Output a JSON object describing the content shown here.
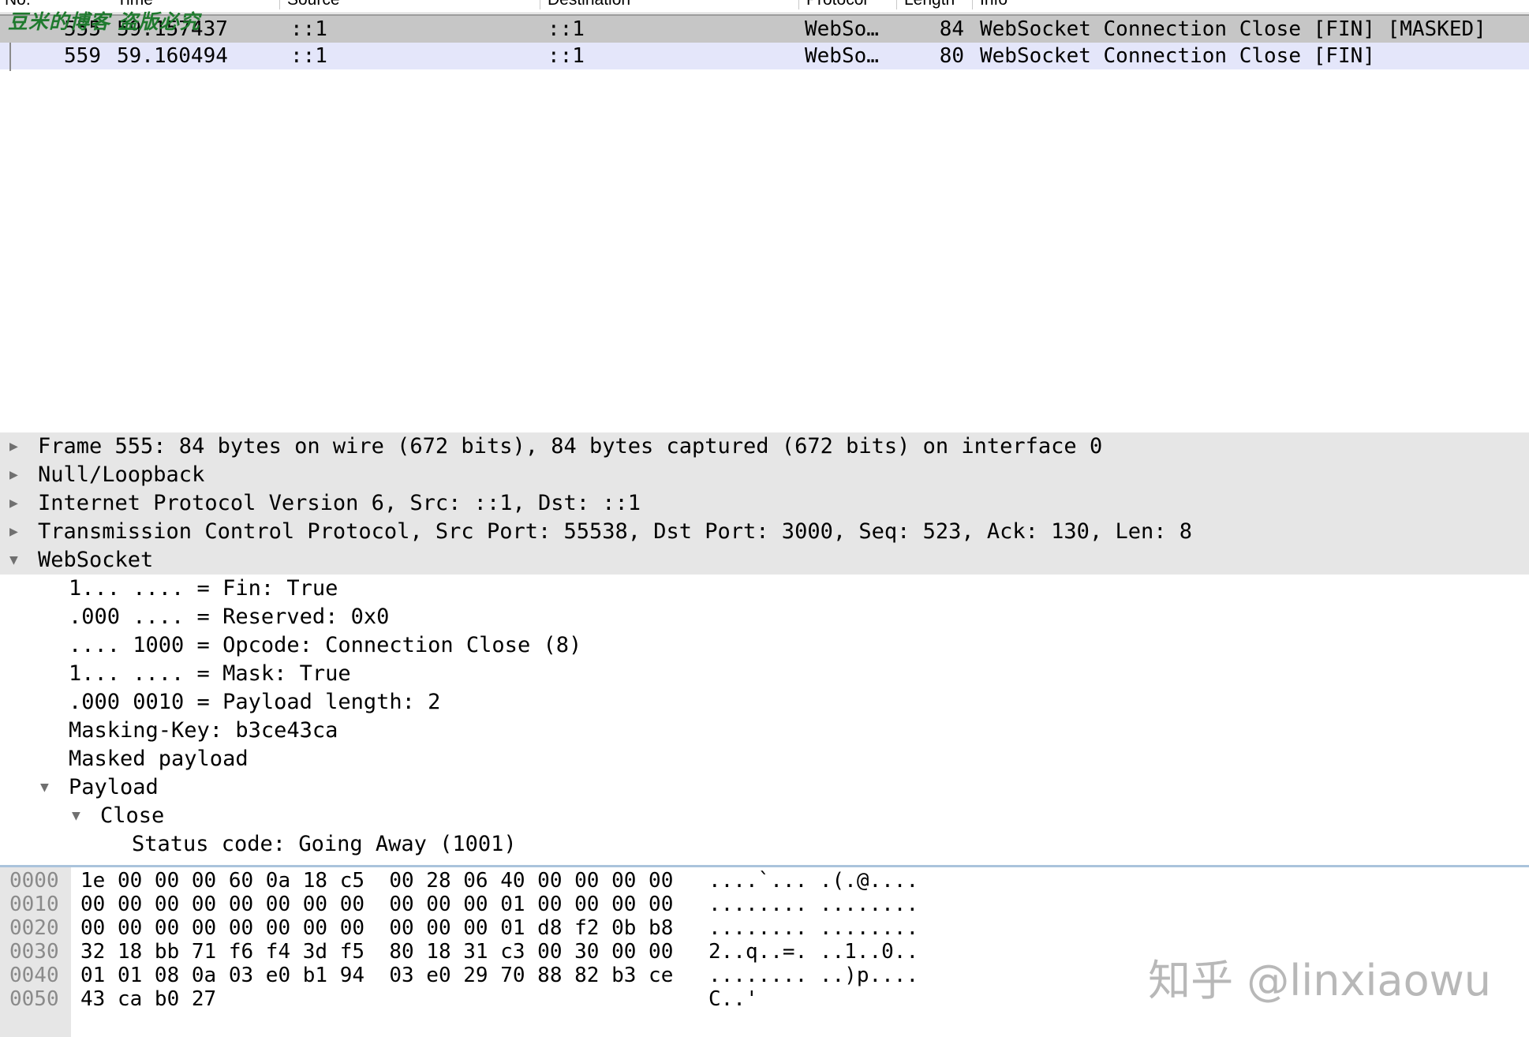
{
  "watermark_top": "豆米的博客 盗版必究",
  "watermark_bottom": "知乎 @linxiaowu",
  "packet_list": {
    "columns": [
      "No.",
      "Time",
      "Source",
      "Destination",
      "Protocol",
      "Length",
      "Info"
    ],
    "rows": [
      {
        "no": "555",
        "time": "59.157437",
        "source": "::1",
        "destination": "::1",
        "protocol": "WebSo…",
        "length": "84",
        "info": "WebSocket Connection Close [FIN] [MASKED]"
      },
      {
        "no": "559",
        "time": "59.160494",
        "source": "::1",
        "destination": "::1",
        "protocol": "WebSo…",
        "length": "80",
        "info": "WebSocket Connection Close [FIN]"
      }
    ]
  },
  "details": {
    "tree": [
      {
        "toggle": "▶",
        "text": "Frame 555: 84 bytes on wire (672 bits), 84 bytes captured (672 bits) on interface 0"
      },
      {
        "toggle": "▶",
        "text": "Null/Loopback"
      },
      {
        "toggle": "▶",
        "text": "Internet Protocol Version 6, Src: ::1, Dst: ::1"
      },
      {
        "toggle": "▶",
        "text": "Transmission Control Protocol, Src Port: 55538, Dst Port: 3000, Seq: 523, Ack: 130, Len: 8"
      },
      {
        "toggle": "▼",
        "text": "WebSocket"
      },
      {
        "toggle": "",
        "text": "1... .... = Fin: True"
      },
      {
        "toggle": "",
        "text": ".000 .... = Reserved: 0x0"
      },
      {
        "toggle": "",
        "text": ".... 1000 = Opcode: Connection Close (8)"
      },
      {
        "toggle": "",
        "text": "1... .... = Mask: True"
      },
      {
        "toggle": "",
        "text": ".000 0010 = Payload length: 2"
      },
      {
        "toggle": "",
        "text": "Masking-Key: b3ce43ca"
      },
      {
        "toggle": "",
        "text": "Masked payload"
      },
      {
        "toggle": "▼",
        "text": "Payload"
      },
      {
        "toggle": "▼",
        "text": "Close"
      },
      {
        "toggle": "",
        "text": "Status code: Going Away (1001)"
      }
    ]
  },
  "bytes": {
    "rows": [
      {
        "offset": "0000",
        "hex": "1e 00 00 00 60 0a 18 c5  00 28 06 40 00 00 00 00",
        "ascii": "....`... .(.@...."
      },
      {
        "offset": "0010",
        "hex": "00 00 00 00 00 00 00 00  00 00 00 01 00 00 00 00",
        "ascii": "........ ........"
      },
      {
        "offset": "0020",
        "hex": "00 00 00 00 00 00 00 00  00 00 00 01 d8 f2 0b b8",
        "ascii": "........ ........"
      },
      {
        "offset": "0030",
        "hex": "32 18 bb 71 f6 f4 3d f5  80 18 31 c3 00 30 00 00",
        "ascii": "2..q..=. ..1..0.."
      },
      {
        "offset": "0040",
        "hex": "01 01 08 0a 03 e0 b1 94  03 e0 29 70 88 82 b3 ce",
        "ascii": "........ ..)p...."
      },
      {
        "offset": "0050",
        "hex": "43 ca b0 27",
        "ascii": "C..'"
      }
    ]
  }
}
